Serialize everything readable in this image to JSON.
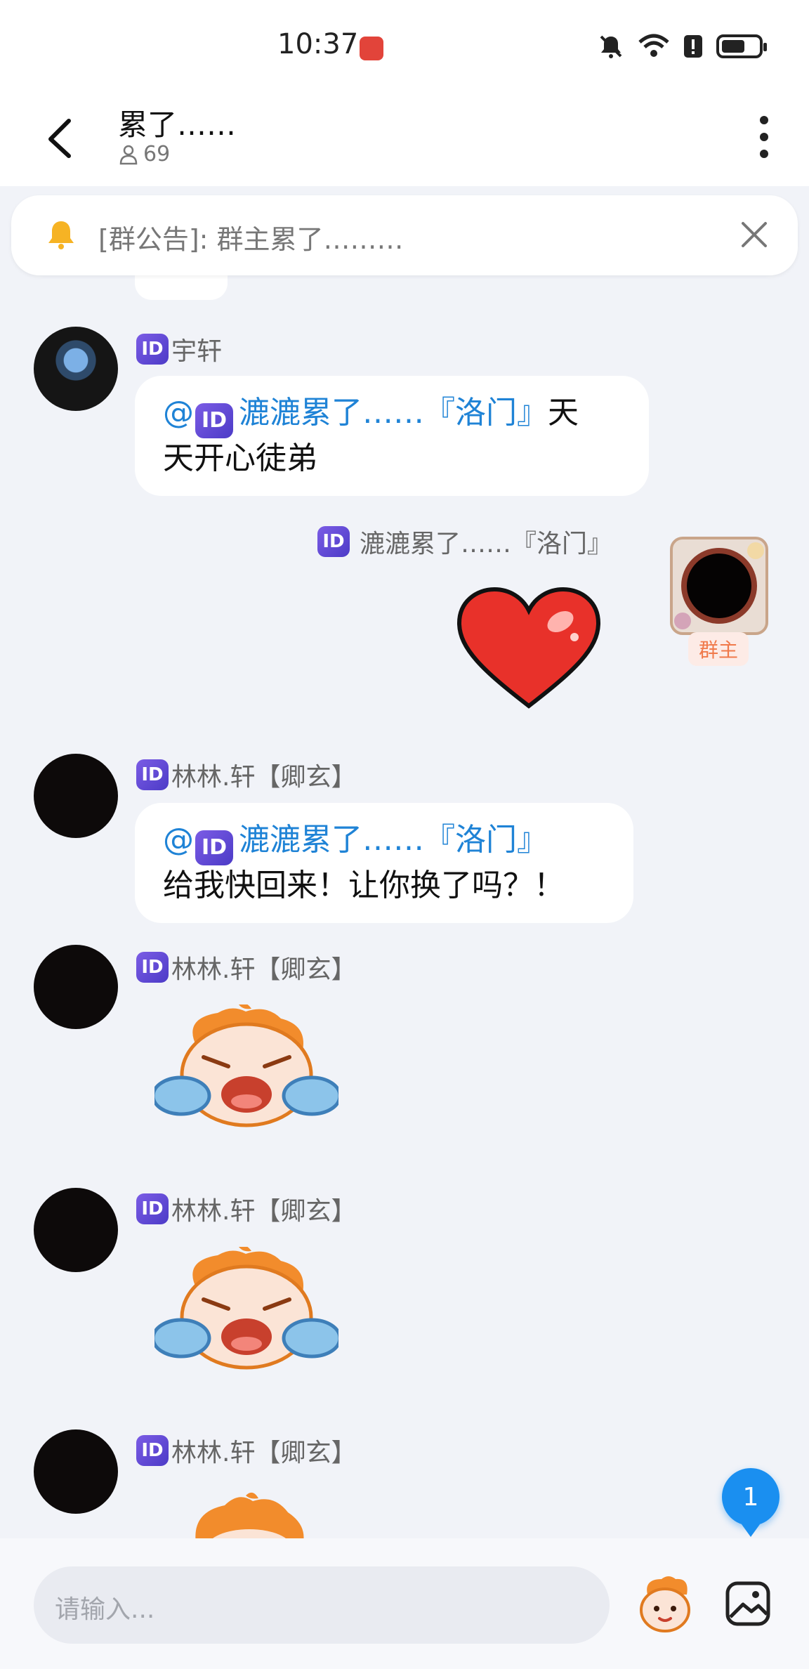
{
  "status_bar": {
    "time": "10:37"
  },
  "header": {
    "title": "累了……",
    "member_count": "69"
  },
  "announcement": {
    "text": "[群公告]: 群主累了………"
  },
  "messages": [
    {
      "sender": "宇轩",
      "badge": "ID",
      "mention": "@",
      "mention_name": "漉漉累了……『洛门』",
      "text_line1": "天",
      "text_line2": "天开心徒弟"
    },
    {
      "sender": "漉漉累了……『洛门』",
      "badge": "ID",
      "role": "群主",
      "content": "heart-sticker"
    },
    {
      "sender": "林林.轩【卿玄】",
      "badge": "ID",
      "mention": "@",
      "mention_name": "漉漉累了……『洛门』",
      "text": "给我快回来！让你换了吗？！"
    },
    {
      "sender": "林林.轩【卿玄】",
      "badge": "ID",
      "content": "crying-sticker"
    },
    {
      "sender": "林林.轩【卿玄】",
      "badge": "ID",
      "content": "crying-sticker"
    },
    {
      "sender": "林林.轩【卿玄】",
      "badge": "ID",
      "content": "crying-sticker"
    }
  ],
  "unread_count": "1",
  "input": {
    "placeholder": "请输入..."
  },
  "colors": {
    "mention": "#1f83d6",
    "unread": "#1a8ff0",
    "owner_badge": "#f07a4b"
  }
}
